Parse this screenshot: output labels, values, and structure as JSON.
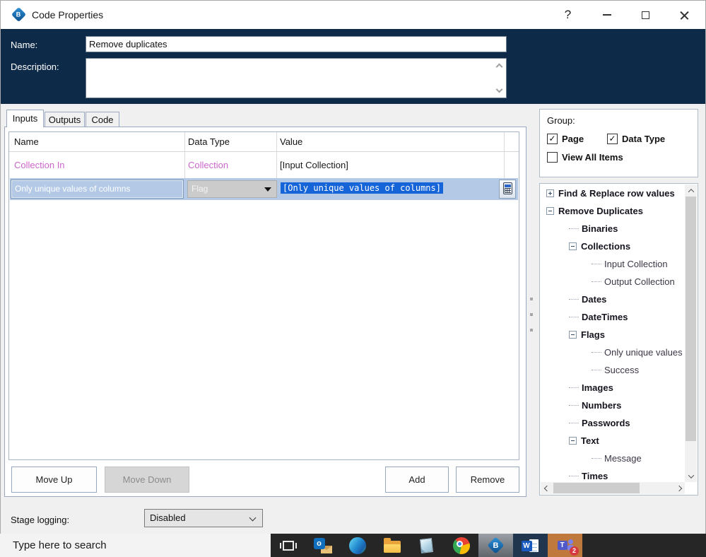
{
  "window": {
    "title": "Code Properties",
    "controls": {
      "help": "?"
    }
  },
  "header": {
    "name_label": "Name:",
    "name_value": "Remove duplicates",
    "description_label": "Description:",
    "description_value": ""
  },
  "tabs": [
    {
      "label": "Inputs",
      "active": true
    },
    {
      "label": "Outputs",
      "active": false
    },
    {
      "label": "Code",
      "active": false
    }
  ],
  "grid": {
    "columns": [
      "Name",
      "Data Type",
      "Value"
    ],
    "rows": [
      {
        "name": "Collection In",
        "data_type": "Collection",
        "value": "[Input Collection]",
        "selected": false
      },
      {
        "name": "Only unique values of columns",
        "data_type": "Flag",
        "value": "[Only unique values of columns]",
        "selected": true
      }
    ]
  },
  "buttons": {
    "move_up": "Move Up",
    "move_down": "Move Down",
    "add": "Add",
    "remove": "Remove"
  },
  "group_panel": {
    "label": "Group:",
    "checkboxes": [
      {
        "label": "Page",
        "checked": true
      },
      {
        "label": "Data Type",
        "checked": true
      },
      {
        "label": "View All Items",
        "checked": false
      }
    ]
  },
  "tree": {
    "items": [
      {
        "label": "Find & Replace row values",
        "level": 0,
        "bold": true,
        "expander": "plus"
      },
      {
        "label": "Remove Duplicates",
        "level": 0,
        "bold": true,
        "expander": "minus"
      },
      {
        "label": "Binaries",
        "level": 1,
        "bold": true,
        "expander": "none"
      },
      {
        "label": "Collections",
        "level": 1,
        "bold": true,
        "expander": "minus"
      },
      {
        "label": "Input Collection",
        "level": 2,
        "bold": false,
        "expander": "none"
      },
      {
        "label": "Output Collection",
        "level": 2,
        "bold": false,
        "expander": "none"
      },
      {
        "label": "Dates",
        "level": 1,
        "bold": true,
        "expander": "none"
      },
      {
        "label": "DateTimes",
        "level": 1,
        "bold": true,
        "expander": "none"
      },
      {
        "label": "Flags",
        "level": 1,
        "bold": true,
        "expander": "minus"
      },
      {
        "label": "Only unique values",
        "level": 2,
        "bold": false,
        "expander": "none"
      },
      {
        "label": "Success",
        "level": 2,
        "bold": false,
        "expander": "none"
      },
      {
        "label": "Images",
        "level": 1,
        "bold": true,
        "expander": "none"
      },
      {
        "label": "Numbers",
        "level": 1,
        "bold": true,
        "expander": "none"
      },
      {
        "label": "Passwords",
        "level": 1,
        "bold": true,
        "expander": "none"
      },
      {
        "label": "Text",
        "level": 1,
        "bold": true,
        "expander": "minus"
      },
      {
        "label": "Message",
        "level": 2,
        "bold": false,
        "expander": "none"
      },
      {
        "label": "Times",
        "level": 1,
        "bold": true,
        "expander": "none"
      }
    ]
  },
  "stage_logging": {
    "label": "Stage logging:",
    "value": "Disabled"
  },
  "taskbar": {
    "search_text": "Type here to search",
    "icons": [
      {
        "name": "task-view-icon",
        "type": "taskview"
      },
      {
        "name": "outlook-icon",
        "type": "outlook",
        "glyph": "o"
      },
      {
        "name": "edge-icon",
        "type": "edge"
      },
      {
        "name": "file-explorer-icon",
        "type": "folder"
      },
      {
        "name": "notepad-icon",
        "type": "notepad"
      },
      {
        "name": "chrome-icon",
        "type": "chrome"
      },
      {
        "name": "blueprism-icon",
        "type": "blueprism",
        "glyph": "B",
        "highlight": "gray"
      },
      {
        "name": "word-icon",
        "type": "word",
        "glyph": "W",
        "highlight": "navy"
      },
      {
        "name": "teams-icon",
        "type": "teams",
        "glyph": "T",
        "highlight": "orange",
        "badge": "2"
      }
    ]
  },
  "colors": {
    "header_navy": "#0e2a49",
    "parameter_pink": "#cc66cc",
    "selected_row_blue": "#b3c9e6",
    "selection_highlight_blue": "#1565d8",
    "teams_highlight_orange": "#c0793c"
  }
}
